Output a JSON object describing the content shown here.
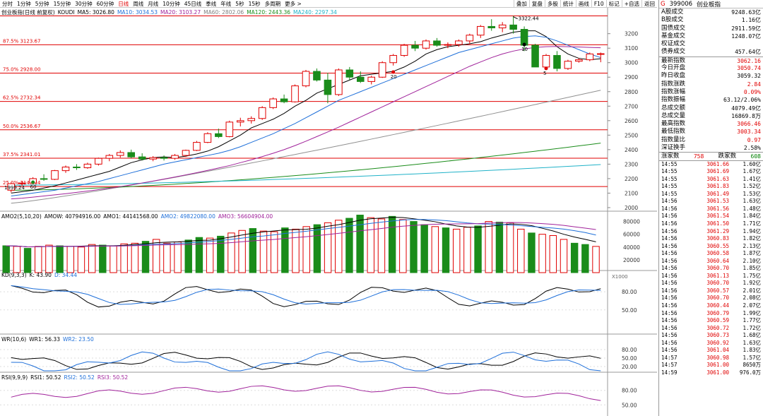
{
  "toolbar": {
    "items": [
      "分时",
      "1分钟",
      "5分钟",
      "15分钟",
      "30分钟",
      "60分钟",
      "日线",
      "周线",
      "月线",
      "10分钟",
      "45日线",
      "季线",
      "年线",
      "5秒",
      "15秒",
      "多周期",
      "更多 >"
    ],
    "active_index": 6,
    "right_items": [
      "叠加",
      "复盘",
      "多股",
      "统计",
      "画线",
      "F10",
      "标记",
      "+自选",
      "返回"
    ]
  },
  "main_chart": {
    "title": "创业板指(日线 前复权)",
    "indicator": "KOUDI",
    "ma_labels": [
      {
        "text": "MA5: 3026.80",
        "color": "#000000"
      },
      {
        "text": "MA10: 3034.53",
        "color": "#1e6fd9"
      },
      {
        "text": "MA20: 3103.27",
        "color": "#a0229a"
      },
      {
        "text": "MA60: 2802.06",
        "color": "#808080"
      },
      {
        "text": "MA120: 2443.36",
        "color": "#1a8c1a"
      },
      {
        "text": "MA240: 2297.34",
        "color": "#20b2c8"
      }
    ],
    "y_ticks": [
      "3200",
      "3100",
      "3000",
      "2900",
      "2800",
      "2700",
      "2600",
      "2500",
      "2400",
      "2300",
      "2200",
      "2100",
      "2000"
    ],
    "fib_lines": [
      "87.5% 3123.67",
      "75.0% 2928.00",
      "62.5% 2732.34",
      "50.0% 2536.67",
      "37.5% 2341.01",
      "25.0% 2145.34"
    ],
    "high_label": "3322.44",
    "low_label": "1999.24",
    "annotations": [
      "20",
      "10",
      "5",
      "60"
    ]
  },
  "chart_data": [
    {
      "type": "candlestick",
      "title": "创业板指(日线 前复权)",
      "ylim": [
        1990,
        3330
      ],
      "ohlc": [
        [
          2120,
          2175,
          2105,
          2165
        ],
        [
          2165,
          2185,
          2150,
          2170
        ],
        [
          2170,
          2210,
          2160,
          2200
        ],
        [
          2200,
          2230,
          2185,
          2195
        ],
        [
          2195,
          2260,
          2190,
          2255
        ],
        [
          2255,
          2290,
          2240,
          2280
        ],
        [
          2280,
          2300,
          2260,
          2275
        ],
        [
          2275,
          2310,
          2268,
          2300
        ],
        [
          2300,
          2345,
          2290,
          2340
        ],
        [
          2340,
          2370,
          2320,
          2360
        ],
        [
          2360,
          2395,
          2345,
          2380
        ],
        [
          2380,
          2400,
          2340,
          2350
        ],
        [
          2350,
          2375,
          2325,
          2335
        ],
        [
          2335,
          2355,
          2320,
          2345
        ],
        [
          2345,
          2360,
          2325,
          2340
        ],
        [
          2340,
          2370,
          2330,
          2360
        ],
        [
          2360,
          2400,
          2350,
          2395
        ],
        [
          2395,
          2460,
          2390,
          2450
        ],
        [
          2450,
          2520,
          2445,
          2510
        ],
        [
          2510,
          2545,
          2480,
          2490
        ],
        [
          2490,
          2600,
          2485,
          2590
        ],
        [
          2590,
          2620,
          2560,
          2600
        ],
        [
          2600,
          2630,
          2580,
          2615
        ],
        [
          2615,
          2700,
          2605,
          2690
        ],
        [
          2690,
          2760,
          2680,
          2750
        ],
        [
          2750,
          2780,
          2720,
          2730
        ],
        [
          2730,
          2850,
          2725,
          2840
        ],
        [
          2840,
          2950,
          2830,
          2940
        ],
        [
          2940,
          2960,
          2870,
          2880
        ],
        [
          2880,
          2930,
          2720,
          2780
        ],
        [
          2780,
          2960,
          2770,
          2950
        ],
        [
          2950,
          2970,
          2880,
          2900
        ],
        [
          2900,
          2940,
          2860,
          2870
        ],
        [
          2870,
          2910,
          2850,
          2900
        ],
        [
          2900,
          3010,
          2895,
          3000
        ],
        [
          3000,
          3060,
          2980,
          3050
        ],
        [
          3050,
          3130,
          3040,
          3120
        ],
        [
          3120,
          3150,
          3080,
          3100
        ],
        [
          3100,
          3160,
          3090,
          3150
        ],
        [
          3150,
          3170,
          3110,
          3120
        ],
        [
          3120,
          3140,
          3100,
          3125
        ],
        [
          3125,
          3160,
          3110,
          3150
        ],
        [
          3150,
          3200,
          3130,
          3190
        ],
        [
          3190,
          3260,
          3170,
          3250
        ],
        [
          3250,
          3300,
          3220,
          3240
        ],
        [
          3240,
          3280,
          3210,
          3260
        ],
        [
          3260,
          3322,
          3200,
          3230
        ],
        [
          3230,
          3250,
          3080,
          3120
        ],
        [
          3120,
          3130,
          2970,
          2970
        ],
        [
          2970,
          3060,
          2950,
          3050
        ],
        [
          3050,
          3080,
          2940,
          2960
        ],
        [
          2960,
          3020,
          2950,
          3010
        ],
        [
          3010,
          3030,
          3000,
          3020
        ],
        [
          3020,
          3070,
          3010,
          3060
        ],
        [
          3060,
          3070,
          3003,
          3062
        ]
      ],
      "ma": {
        "MA5": [
          2100,
          2110,
          2120,
          2135,
          2150,
          2170,
          2190,
          2210,
          2230,
          2250,
          2280,
          2310,
          2330,
          2345,
          2350,
          2345,
          2355,
          2370,
          2390,
          2420,
          2460,
          2500,
          2550,
          2580,
          2610,
          2650,
          2700,
          2740,
          2790,
          2820,
          2850,
          2880,
          2910,
          2920,
          2930,
          2940,
          2970,
          3010,
          3060,
          3090,
          3110,
          3120,
          3130,
          3145,
          3170,
          3190,
          3210,
          3220,
          3220,
          3180,
          3110,
          3060,
          3030,
          3020,
          3027
        ],
        "MA10": [
          2080,
          2090,
          2100,
          2110,
          2120,
          2135,
          2150,
          2165,
          2180,
          2200,
          2220,
          2240,
          2260,
          2280,
          2300,
          2315,
          2330,
          2345,
          2360,
          2375,
          2395,
          2420,
          2450,
          2480,
          2510,
          2545,
          2580,
          2620,
          2660,
          2700,
          2740,
          2770,
          2800,
          2830,
          2860,
          2890,
          2920,
          2950,
          2980,
          3010,
          3040,
          3070,
          3090,
          3110,
          3130,
          3150,
          3170,
          3180,
          3185,
          3175,
          3150,
          3120,
          3090,
          3060,
          3035
        ],
        "MA20": [
          2060,
          2065,
          2072,
          2080,
          2088,
          2096,
          2105,
          2114,
          2124,
          2134,
          2145,
          2157,
          2170,
          2183,
          2197,
          2211,
          2226,
          2241,
          2257,
          2273,
          2290,
          2310,
          2330,
          2352,
          2375,
          2400,
          2428,
          2458,
          2490,
          2522,
          2555,
          2590,
          2625,
          2660,
          2695,
          2730,
          2765,
          2800,
          2835,
          2870,
          2905,
          2940,
          2975,
          3005,
          3035,
          3060,
          3080,
          3095,
          3105,
          3110,
          3112,
          3110,
          3108,
          3105,
          3103
        ]
      },
      "ma_long": {
        "MA60": [
          2030,
          2810
        ],
        "MA120": [
          2120,
          2445
        ],
        "MA240": [
          2155,
          2297
        ]
      }
    },
    {
      "type": "bar",
      "title": "AMO2(5,10,20)",
      "legend": [
        "AMOW: 40794916.00",
        "AMO1: 44141568.00",
        "AMO2: 49822080.00",
        "AMO3: 56604904.00"
      ],
      "y_ticks": [
        "80000",
        "60000",
        "40000",
        "20000"
      ],
      "unit_label": "X1000",
      "ylim": [
        0,
        95000
      ],
      "values": [
        42000,
        41000,
        38000,
        41000,
        43000,
        42000,
        41000,
        40000,
        44000,
        43000,
        42000,
        45000,
        46000,
        49000,
        52000,
        46000,
        48000,
        51000,
        55000,
        54000,
        57000,
        62000,
        66000,
        69000,
        65000,
        64000,
        70000,
        68000,
        72000,
        75000,
        78000,
        82000,
        85000,
        90000,
        86000,
        84000,
        88000,
        83000,
        80000,
        75000,
        72000,
        70000,
        68000,
        71000,
        73000,
        80000,
        79000,
        78000,
        68000,
        62000,
        60000,
        58000,
        52000,
        46000,
        44000,
        41000
      ],
      "up": [
        false,
        true,
        false,
        true,
        true,
        false,
        true,
        true,
        true,
        false,
        true,
        true,
        true,
        false,
        true,
        true,
        true,
        false,
        false,
        true,
        false,
        true,
        true,
        false,
        true,
        true,
        false,
        true,
        true,
        false,
        true,
        true,
        false,
        false,
        true,
        true,
        false,
        true,
        false,
        false,
        true,
        false,
        true,
        true,
        false,
        true,
        false,
        true,
        true,
        false,
        true,
        true,
        true,
        false,
        false,
        true
      ]
    },
    {
      "type": "line",
      "title": "KD(9,3,3)",
      "legend": [
        "K: 43.90",
        "D: 34.44"
      ],
      "y_ticks": [
        "80.00",
        "50.00"
      ],
      "ylim": [
        10,
        100
      ]
    },
    {
      "type": "line",
      "title": "WR(10,6)",
      "legend": [
        "WR1: 56.33",
        "WR2: 23.50"
      ],
      "y_ticks": [
        "80.00",
        "50.00",
        "20.00"
      ],
      "ylim": [
        0,
        100
      ]
    },
    {
      "type": "line",
      "title": "RSI(9,9,9)",
      "legend": [
        "RSI1: 50.52",
        "RSI2: 50.52",
        "RSI3: 50.52"
      ],
      "y_ticks": [
        "80.00",
        "50.00"
      ],
      "ylim": [
        30,
        100
      ]
    }
  ],
  "quote_panel": {
    "code": "399006",
    "name": "创业板指",
    "marker": "G",
    "rows": [
      {
        "label": "A股成交",
        "value": "9248.63亿",
        "color": "black"
      },
      {
        "label": "B股成交",
        "value": "1.16亿",
        "color": "black"
      },
      {
        "label": "国债成交",
        "value": "2911.59亿",
        "color": "black"
      },
      {
        "label": "基金成交",
        "value": "1248.07亿",
        "color": "black"
      },
      {
        "label": "权证成交",
        "value": "",
        "color": "black"
      },
      {
        "label": "债券成交",
        "value": "457.64亿",
        "color": "black"
      },
      {
        "label": "最新指数",
        "value": "3062.16",
        "color": "red"
      },
      {
        "label": "今日开盘",
        "value": "3050.74",
        "color": "red"
      },
      {
        "label": "昨日收盘",
        "value": "3059.32",
        "color": "black"
      },
      {
        "label": "指数涨跌",
        "value": "2.84",
        "color": "red"
      },
      {
        "label": "指数涨幅",
        "value": "0.09%",
        "color": "red"
      },
      {
        "label": "指数振幅",
        "value": "63.12/2.06%",
        "color": "black"
      },
      {
        "label": "总成交额",
        "value": "4079.49亿",
        "color": "black"
      },
      {
        "label": "总成交量",
        "value": "16869.8万",
        "color": "black"
      },
      {
        "label": "最高指数",
        "value": "3066.46",
        "color": "red"
      },
      {
        "label": "最低指数",
        "value": "3003.34",
        "color": "red"
      },
      {
        "label": "指数量比",
        "value": "0.97",
        "color": "red"
      },
      {
        "label": "深证换手",
        "value": "2.58%",
        "color": "black"
      }
    ],
    "up_down": {
      "up_label": "涨家数",
      "up_value": "758",
      "down_label": "跌家数",
      "down_value": "608"
    },
    "ticks": [
      [
        "14:55",
        "3061.66",
        "1.60亿"
      ],
      [
        "14:55",
        "3061.69",
        "1.67亿"
      ],
      [
        "14:55",
        "3061.63",
        "1.41亿"
      ],
      [
        "14:55",
        "3061.83",
        "1.52亿"
      ],
      [
        "14:55",
        "3061.49",
        "1.53亿"
      ],
      [
        "14:56",
        "3061.53",
        "1.63亿"
      ],
      [
        "14:56",
        "3061.56",
        "1.48亿"
      ],
      [
        "14:56",
        "3061.54",
        "1.84亿"
      ],
      [
        "14:56",
        "3061.50",
        "1.71亿"
      ],
      [
        "14:56",
        "3061.29",
        "1.94亿"
      ],
      [
        "14:56",
        "3060.83",
        "1.82亿"
      ],
      [
        "14:56",
        "3060.55",
        "2.13亿"
      ],
      [
        "14:56",
        "3060.58",
        "1.87亿"
      ],
      [
        "14:56",
        "3060.64",
        "2.10亿"
      ],
      [
        "14:56",
        "3060.70",
        "1.85亿"
      ],
      [
        "14:56",
        "3061.13",
        "1.75亿"
      ],
      [
        "14:56",
        "3060.70",
        "1.92亿"
      ],
      [
        "14:56",
        "3060.57",
        "2.01亿"
      ],
      [
        "14:56",
        "3060.70",
        "2.08亿"
      ],
      [
        "14:56",
        "3060.44",
        "2.07亿"
      ],
      [
        "14:56",
        "3060.79",
        "1.99亿"
      ],
      [
        "14:56",
        "3060.59",
        "1.77亿"
      ],
      [
        "14:56",
        "3060.72",
        "1.72亿"
      ],
      [
        "14:56",
        "3060.73",
        "1.68亿"
      ],
      [
        "14:56",
        "3060.92",
        "1.63亿"
      ],
      [
        "14:56",
        "3061.04",
        "1.83亿"
      ],
      [
        "14:57",
        "3060.98",
        "1.57亿"
      ],
      [
        "14:57",
        "3061.00",
        "8650万"
      ],
      [
        "14:59",
        "3061.00",
        "976.0万"
      ]
    ]
  }
}
